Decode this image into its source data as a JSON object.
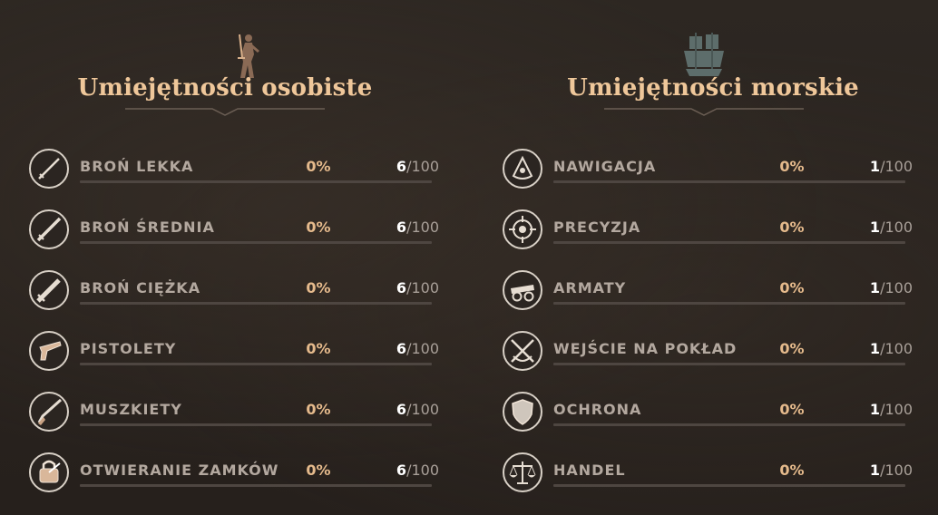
{
  "personal": {
    "title": "Umiejętności osobiste",
    "emblem": "swordsman-icon",
    "skills": [
      {
        "name": "BROŃ LEKKA",
        "percent": "0%",
        "level": "6",
        "max": "/100",
        "progress": 0,
        "icon": "light-sword-icon"
      },
      {
        "name": "BROŃ ŚREDNIA",
        "percent": "0%",
        "level": "6",
        "max": "/100",
        "progress": 0,
        "icon": "medium-sword-icon"
      },
      {
        "name": "BROŃ CIĘŻKA",
        "percent": "0%",
        "level": "6",
        "max": "/100",
        "progress": 0,
        "icon": "heavy-sword-icon"
      },
      {
        "name": "PISTOLETY",
        "percent": "0%",
        "level": "6",
        "max": "/100",
        "progress": 0,
        "icon": "pistol-icon"
      },
      {
        "name": "MUSZKIETY",
        "percent": "0%",
        "level": "6",
        "max": "/100",
        "progress": 0,
        "icon": "musket-icon"
      },
      {
        "name": "OTWIERANIE ZAMKÓW",
        "percent": "0%",
        "level": "6",
        "max": "/100",
        "progress": 0,
        "icon": "lockpick-icon"
      }
    ]
  },
  "naval": {
    "title": "Umiejętności morskie",
    "emblem": "ship-icon",
    "skills": [
      {
        "name": "NAWIGACJA",
        "percent": "0%",
        "level": "1",
        "max": "/100",
        "progress": 0,
        "icon": "sextant-icon"
      },
      {
        "name": "PRECYZJA",
        "percent": "0%",
        "level": "1",
        "max": "/100",
        "progress": 0,
        "icon": "crosshair-icon"
      },
      {
        "name": "ARMATY",
        "percent": "0%",
        "level": "1",
        "max": "/100",
        "progress": 0,
        "icon": "cannon-icon"
      },
      {
        "name": "WEJŚCIE NA POKŁAD",
        "percent": "0%",
        "level": "1",
        "max": "/100",
        "progress": 0,
        "icon": "boarding-icon"
      },
      {
        "name": "OCHRONA",
        "percent": "0%",
        "level": "1",
        "max": "/100",
        "progress": 0,
        "icon": "shield-icon"
      },
      {
        "name": "HANDEL",
        "percent": "0%",
        "level": "1",
        "max": "/100",
        "progress": 0,
        "icon": "scales-icon"
      }
    ]
  },
  "colors": {
    "title": "#efc79a",
    "percent": "#e5ba8c",
    "name": "#b3a89f",
    "bar": "#4e4641"
  }
}
